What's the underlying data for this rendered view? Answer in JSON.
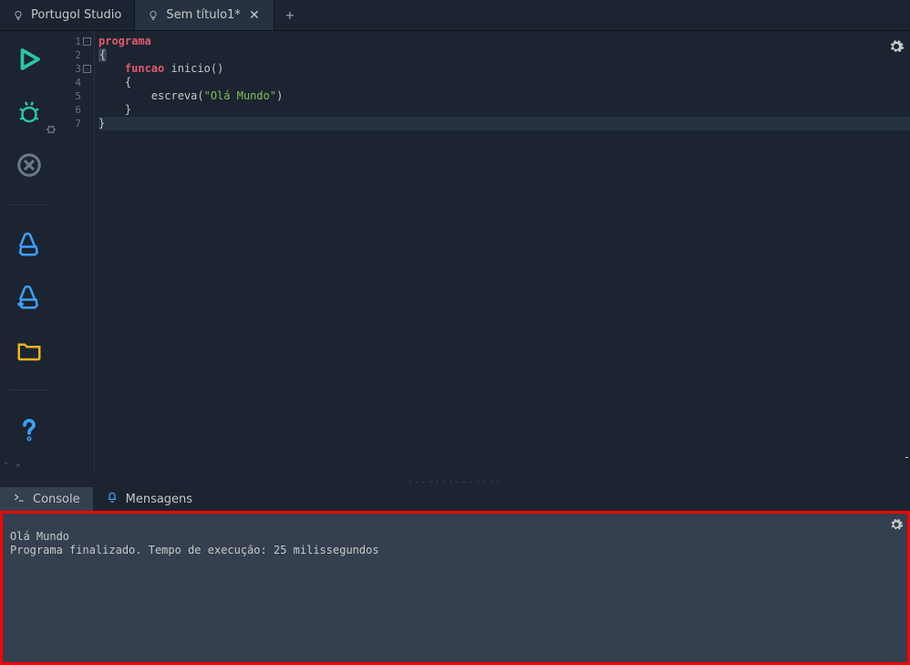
{
  "tabs": {
    "home": {
      "label": "Portugol Studio"
    },
    "active": {
      "label": "Sem título1*"
    }
  },
  "sidebar": {
    "run": "run",
    "debug": "debug",
    "stop": "stop",
    "save": "save",
    "saveAs": "save-as",
    "open": "open",
    "help": "help"
  },
  "gutter": {
    "lines": [
      "1",
      "2",
      "3",
      "4",
      "5",
      "6",
      "7"
    ],
    "fold_at": [
      1,
      3
    ]
  },
  "code": {
    "l1": {
      "kw": "programa"
    },
    "l2": {
      "brace": "{"
    },
    "l3": {
      "indent": "    ",
      "kw": "funcao",
      "name": " inicio",
      "paren": "()"
    },
    "l4": {
      "indent": "    ",
      "brace": "{"
    },
    "l5": {
      "indent": "        ",
      "fn": "escreva",
      "open": "(",
      "str": "\"Olá Mundo\"",
      "close": ")"
    },
    "l6": {
      "indent": "    ",
      "brace": "}"
    },
    "l7": {
      "brace": "}"
    }
  },
  "bottom_tabs": {
    "console": "Console",
    "messages": "Mensagens"
  },
  "console": {
    "line1": "Olá Mundo",
    "line2": "Programa finalizado. Tempo de execução: 25 milissegundos"
  },
  "resize_dots": "..............",
  "chevrons": "^  >"
}
